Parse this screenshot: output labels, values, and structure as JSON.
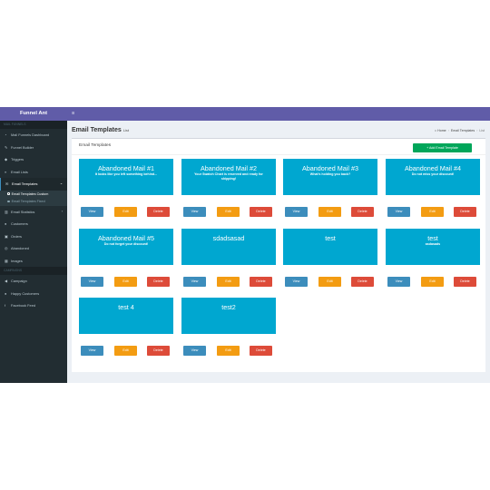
{
  "app": {
    "brand": "Funnel Ant"
  },
  "sidebar": {
    "section_main": "MAIL FUNNELS",
    "items": [
      {
        "label": "Mail Funnels Dashboard",
        "icon": "dashboard-icon"
      },
      {
        "label": "Funnel Builder",
        "icon": "pencil-icon"
      },
      {
        "label": "Triggers",
        "icon": "tag-icon"
      },
      {
        "label": "Email Lists",
        "icon": "list-icon"
      },
      {
        "label": "Email Templates",
        "icon": "envelope-icon",
        "active": true
      }
    ],
    "subitems": [
      {
        "label": "Email Templates Custom",
        "active": true
      },
      {
        "label": "Email Templates Fixed",
        "active": false
      }
    ],
    "items2": [
      {
        "label": "Email Statistics",
        "icon": "chart-icon"
      },
      {
        "label": "Customers",
        "icon": "users-icon"
      },
      {
        "label": "Orders",
        "icon": "cart-icon"
      },
      {
        "label": "Abandoned",
        "icon": "cart-x-icon"
      },
      {
        "label": "Images",
        "icon": "image-icon"
      }
    ],
    "section_campaign": "CAMPAIGNS",
    "items3": [
      {
        "label": "Campaign",
        "icon": "megaphone-icon"
      },
      {
        "label": "Happy Customers",
        "icon": "users-icon"
      },
      {
        "label": "Facebook Feed",
        "icon": "facebook-icon"
      }
    ]
  },
  "header": {
    "title": "Email Templates",
    "subtitle": "List",
    "breadcrumb": [
      "Home",
      "Email Templates",
      "List"
    ]
  },
  "box": {
    "title": "Email Templates",
    "add_button": "+ Add Email Template"
  },
  "buttons": {
    "view": "View",
    "edit": "Edit",
    "delete": "Delete"
  },
  "templates": [
    {
      "title": "Abandoned Mail #1",
      "subtitle": "It looks like you left something behind..."
    },
    {
      "title": "Abandoned Mail #2",
      "subtitle": "Your Swatch Chart is reserved and ready for shipping!"
    },
    {
      "title": "Abandoned Mail #3",
      "subtitle": "What's holding you back?"
    },
    {
      "title": "Abandoned Mail #4",
      "subtitle": "Do not miss your discount!"
    },
    {
      "title": "Abandoned Mail #5",
      "subtitle": "Do not forget your discount!"
    },
    {
      "title": "sdadsasad",
      "subtitle": ""
    },
    {
      "title": "test",
      "subtitle": ""
    },
    {
      "title": "test",
      "subtitle": "asdasads"
    },
    {
      "title": "test 4",
      "subtitle": ""
    },
    {
      "title": "test2",
      "subtitle": ""
    }
  ],
  "colors": {
    "brand": "#605ca8",
    "sidebar": "#222d32",
    "tile": "#00a7d0",
    "view": "#3c8dbc",
    "edit": "#f39c12",
    "delete": "#dd4b39",
    "add": "#00a65a"
  }
}
